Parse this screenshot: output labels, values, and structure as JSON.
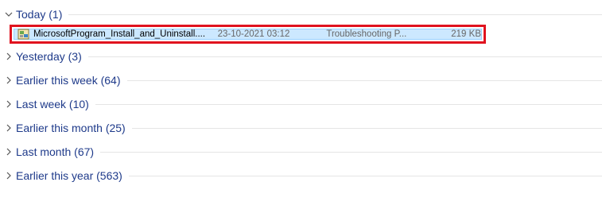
{
  "groups": [
    {
      "label": "Today (1)",
      "expanded": true
    },
    {
      "label": "Yesterday (3)",
      "expanded": false
    },
    {
      "label": "Earlier this week (64)",
      "expanded": false
    },
    {
      "label": "Last week (10)",
      "expanded": false
    },
    {
      "label": "Earlier this month (25)",
      "expanded": false
    },
    {
      "label": "Last month (67)",
      "expanded": false
    },
    {
      "label": "Earlier this year (563)",
      "expanded": false
    }
  ],
  "file": {
    "name": "MicrosoftProgram_Install_and_Uninstall....",
    "date_modified": "23-10-2021 03:12",
    "type": "Troubleshooting P...",
    "size": "219 KB",
    "icon": "troubleshooter-file-icon",
    "selected": true,
    "highlight_color": "#e0131f"
  },
  "colors": {
    "group_text": "#1e3a8a",
    "selection_bg": "#cce8ff"
  }
}
